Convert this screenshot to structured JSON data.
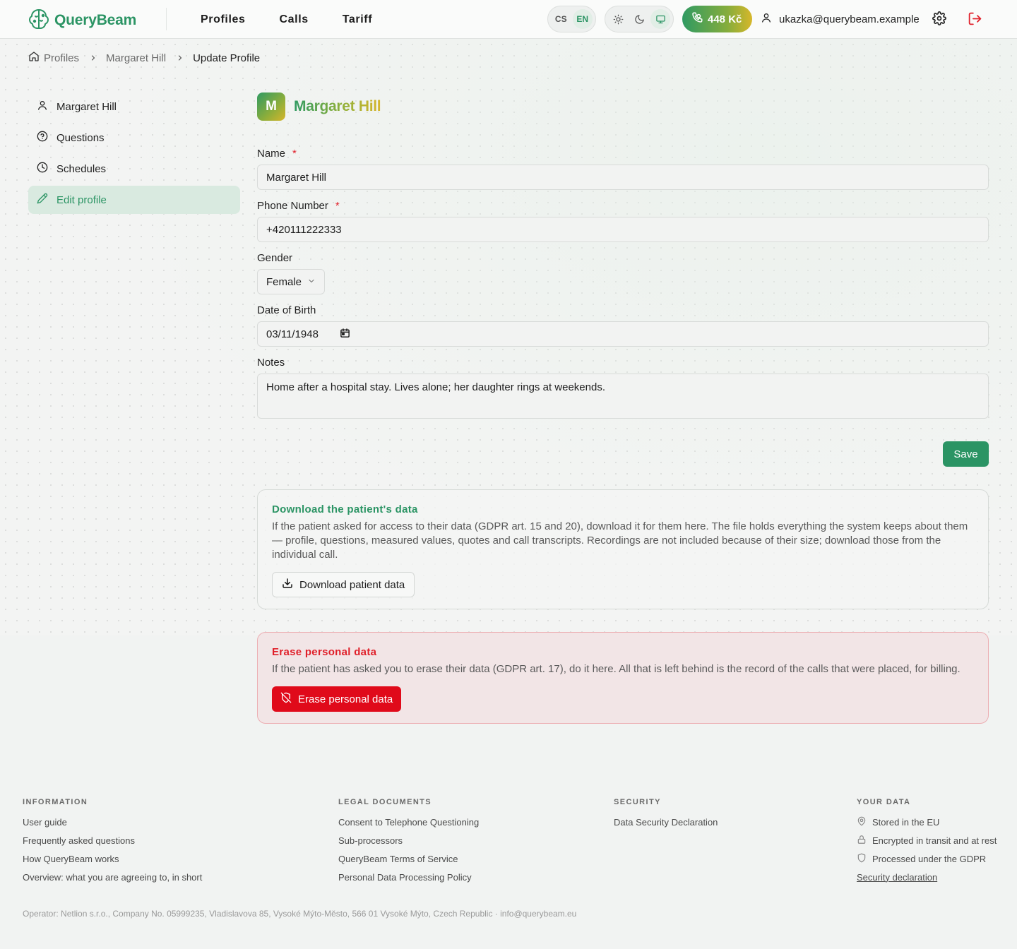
{
  "app": {
    "name": "QueryBeam",
    "brand_color": "#2b9464"
  },
  "nav": {
    "items": [
      "Profiles",
      "Calls",
      "Tariff"
    ]
  },
  "header": {
    "languages": [
      "CS",
      "EN"
    ],
    "active_language": "EN",
    "theme_options": [
      "light-theme-icon",
      "dark-theme-icon",
      "system-theme-icon"
    ],
    "active_theme": "system",
    "credit": "448 Kč",
    "user_email": "ukazka@querybeam.example"
  },
  "breadcrumb": {
    "items": [
      "Profiles",
      "Margaret Hill",
      "Update Profile"
    ]
  },
  "sidebar": {
    "items": [
      {
        "label": "Margaret Hill",
        "icon": "user-icon"
      },
      {
        "label": "Questions",
        "icon": "help-circle-icon"
      },
      {
        "label": "Schedules",
        "icon": "clock-icon"
      },
      {
        "label": "Edit profile",
        "icon": "pencil-icon"
      }
    ],
    "active": "Edit profile"
  },
  "profile": {
    "initial": "M",
    "name": "Margaret Hill"
  },
  "form": {
    "name_label": "Name",
    "name_value": "Margaret Hill",
    "phone_label": "Phone Number",
    "phone_value": "+420111222333",
    "gender_label": "Gender",
    "gender_value": "Female",
    "dob_label": "Date of Birth",
    "dob_value": "03/11/1948",
    "notes_label": "Notes",
    "notes_value": "Home after a hospital stay. Lives alone; her daughter rings at weekends.",
    "required_mark": "*",
    "save_label": "Save"
  },
  "download_card": {
    "title": "Download the patient's data",
    "text": "If the patient asked for access to their data (GDPR art. 15 and 20), download it for them here. The file holds everything the system keeps about them — profile, questions, measured values, quotes and call transcripts. Recordings are not included because of their size; download those from the individual call.",
    "button": "Download patient data"
  },
  "erase_card": {
    "title": "Erase personal data",
    "text": "If the patient has asked you to erase their data (GDPR art. 17), do it here. All that is left behind is the record of the calls that were placed, for billing.",
    "button": "Erase personal data",
    "danger_color": "#e00a1a"
  },
  "footer": {
    "information": {
      "title": "INFORMATION",
      "links": [
        "User guide",
        "Frequently asked questions",
        "How QueryBeam works",
        "Overview: what you are agreeing to, in short"
      ]
    },
    "legal": {
      "title": "LEGAL DOCUMENTS",
      "links": [
        "Consent to Telephone Questioning",
        "Sub-processors",
        "QueryBeam Terms of Service",
        "Personal Data Processing Policy"
      ]
    },
    "security": {
      "title": "SECURITY",
      "links": [
        "Data Security Declaration"
      ]
    },
    "your_data": {
      "title": "YOUR DATA",
      "items": [
        {
          "label": "Stored in the EU",
          "icon": "map-pin-icon"
        },
        {
          "label": "Encrypted in transit and at rest",
          "icon": "lock-icon"
        },
        {
          "label": "Processed under the GDPR",
          "icon": "shield-icon"
        }
      ],
      "link": "Security declaration"
    },
    "operator": "Operator: Netlion s.r.o., Company No. 05999235, Vladislavova 85, Vysoké Mýto-Město, 566 01 Vysoké Mýto, Czech Republic · info@querybeam.eu"
  }
}
